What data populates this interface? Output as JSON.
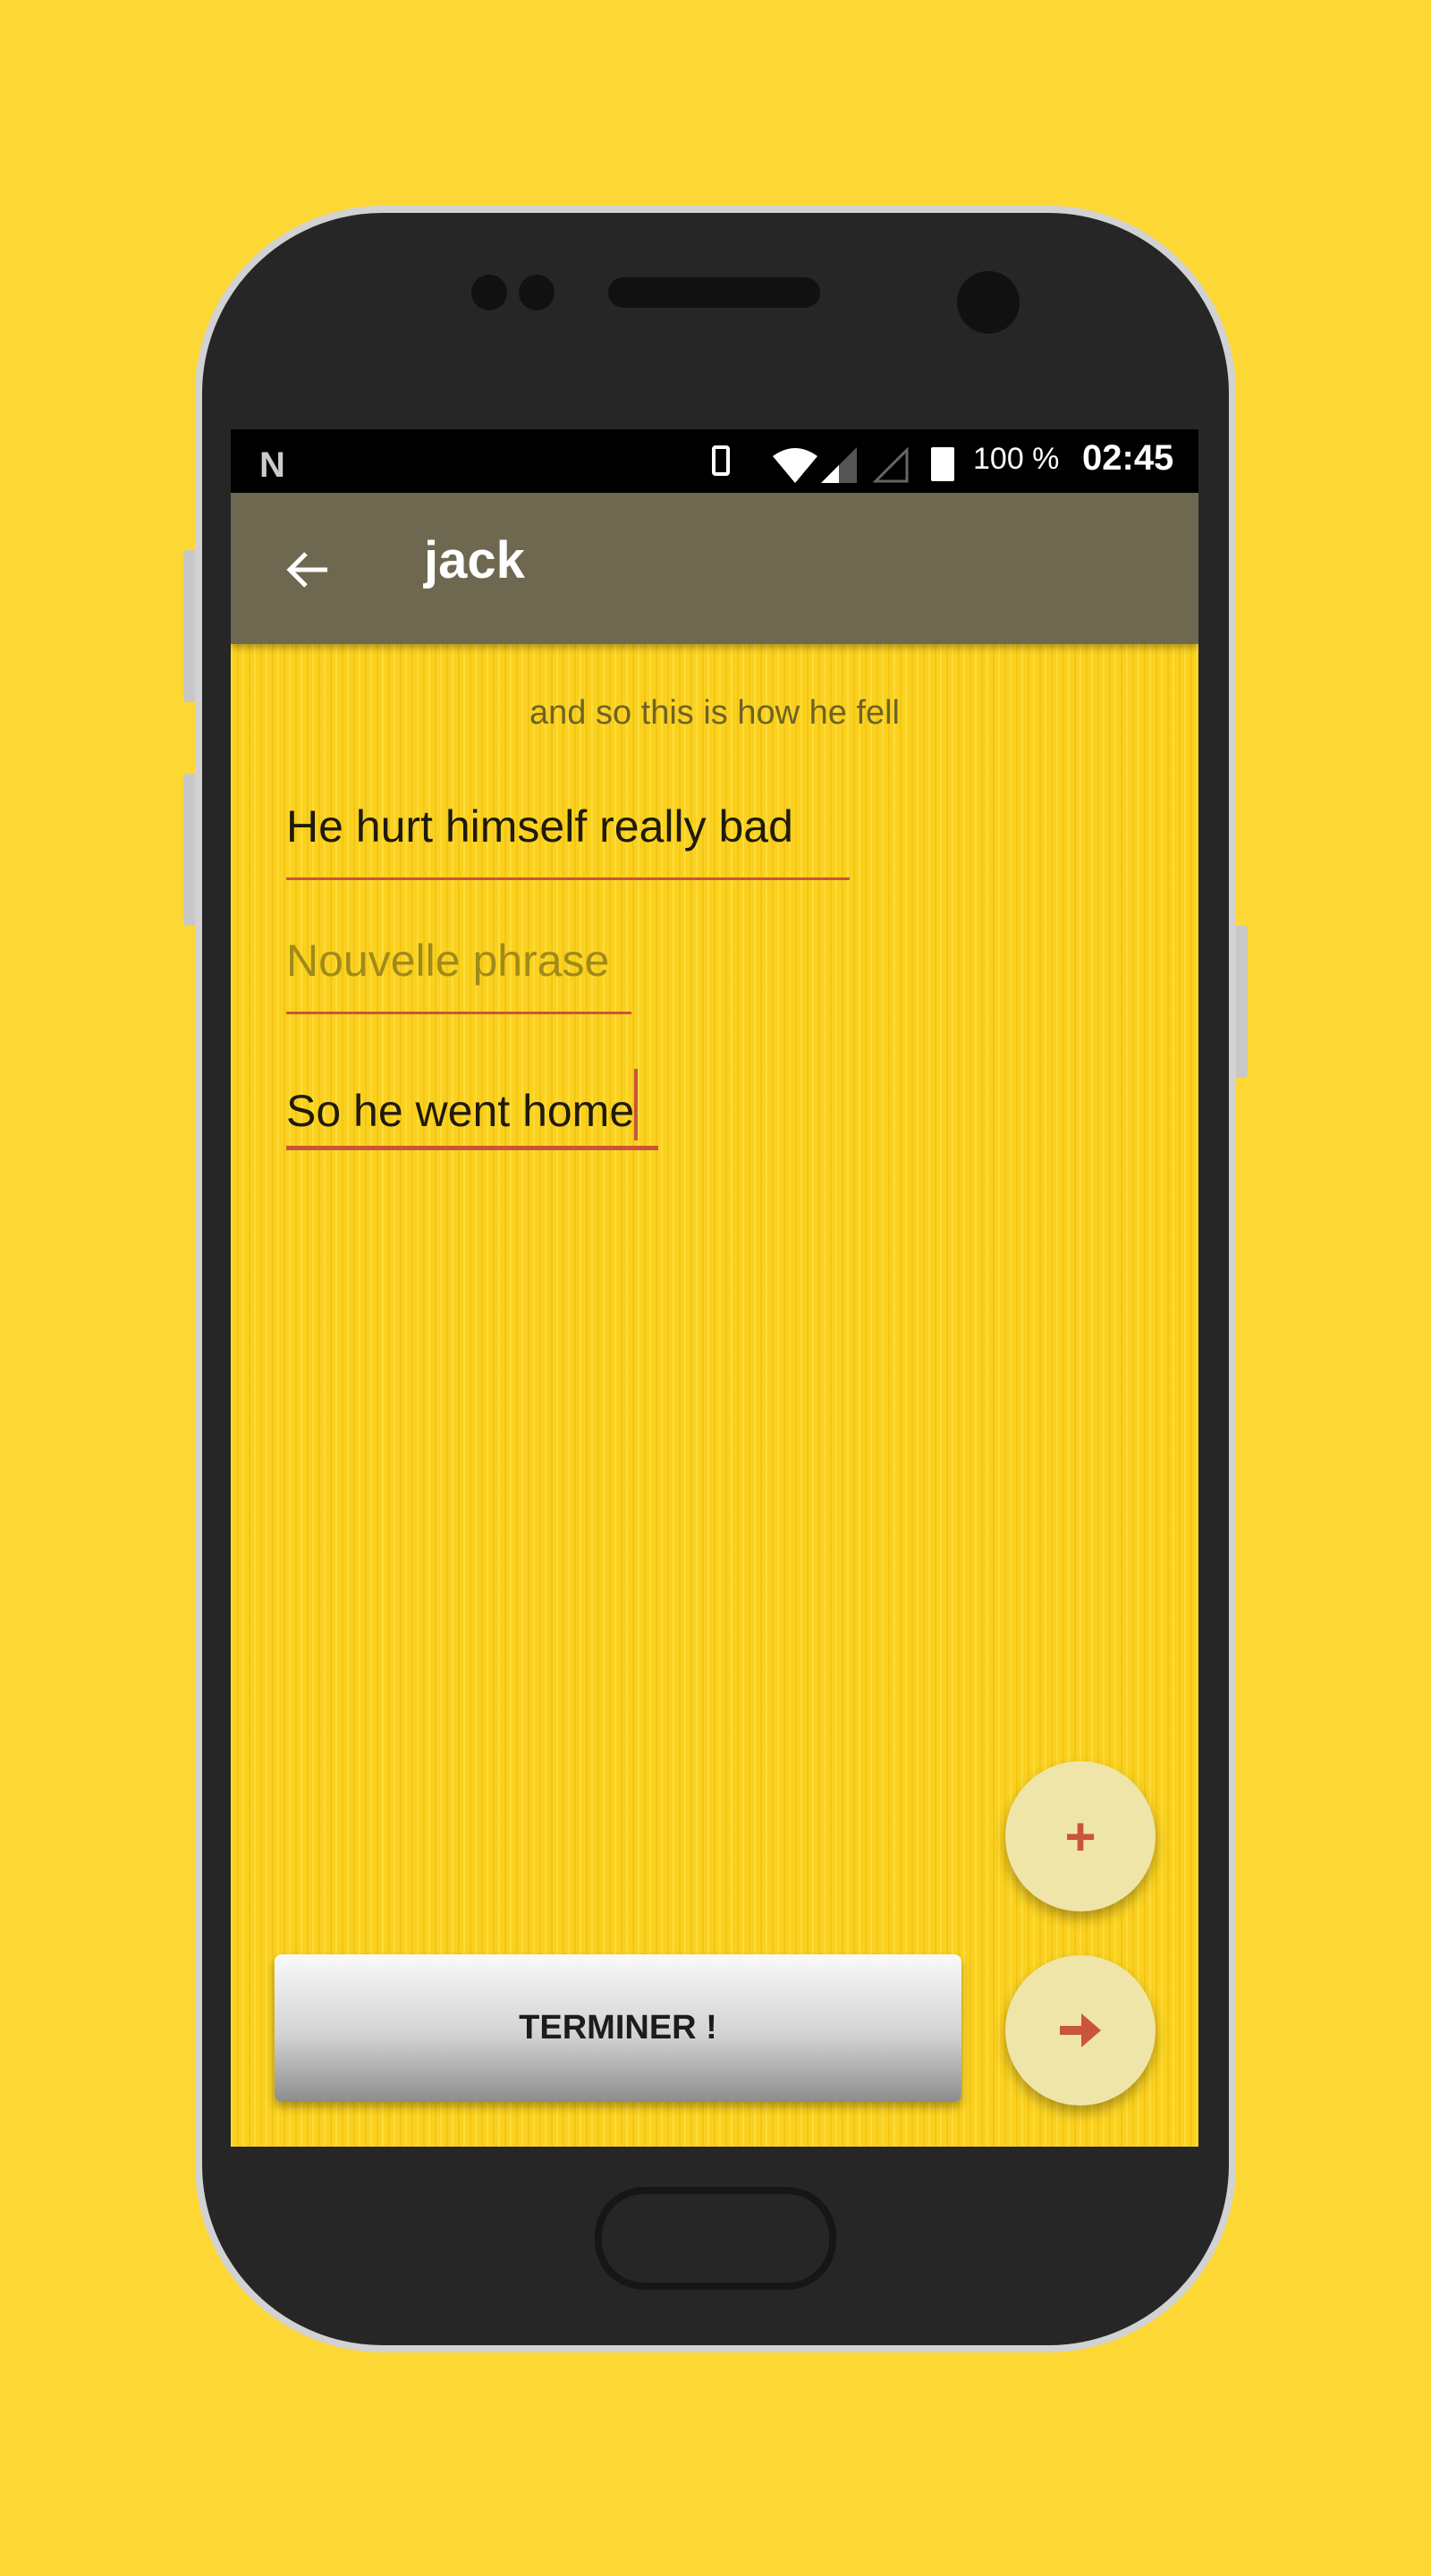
{
  "status_bar": {
    "notification_icon": "n-icon",
    "battery_percent": "100 %",
    "time": "02:45"
  },
  "toolbar": {
    "title": "jack",
    "back_icon": "arrow-left-icon"
  },
  "prompt": "and so this is how he fell",
  "fields": [
    {
      "value": "He hurt himself really bad",
      "placeholder": ""
    },
    {
      "value": "",
      "placeholder": "Nouvelle phrase"
    },
    {
      "value": "So he went home",
      "placeholder": "",
      "focused": true
    }
  ],
  "actions": {
    "finish_label": "TERMINER !",
    "add_icon": "plus-icon",
    "next_icon": "arrow-right-icon"
  },
  "colors": {
    "background": "#fdd835",
    "toolbar": "#6f6851",
    "accent": "#c9553b",
    "fab": "#f0e5a8"
  }
}
